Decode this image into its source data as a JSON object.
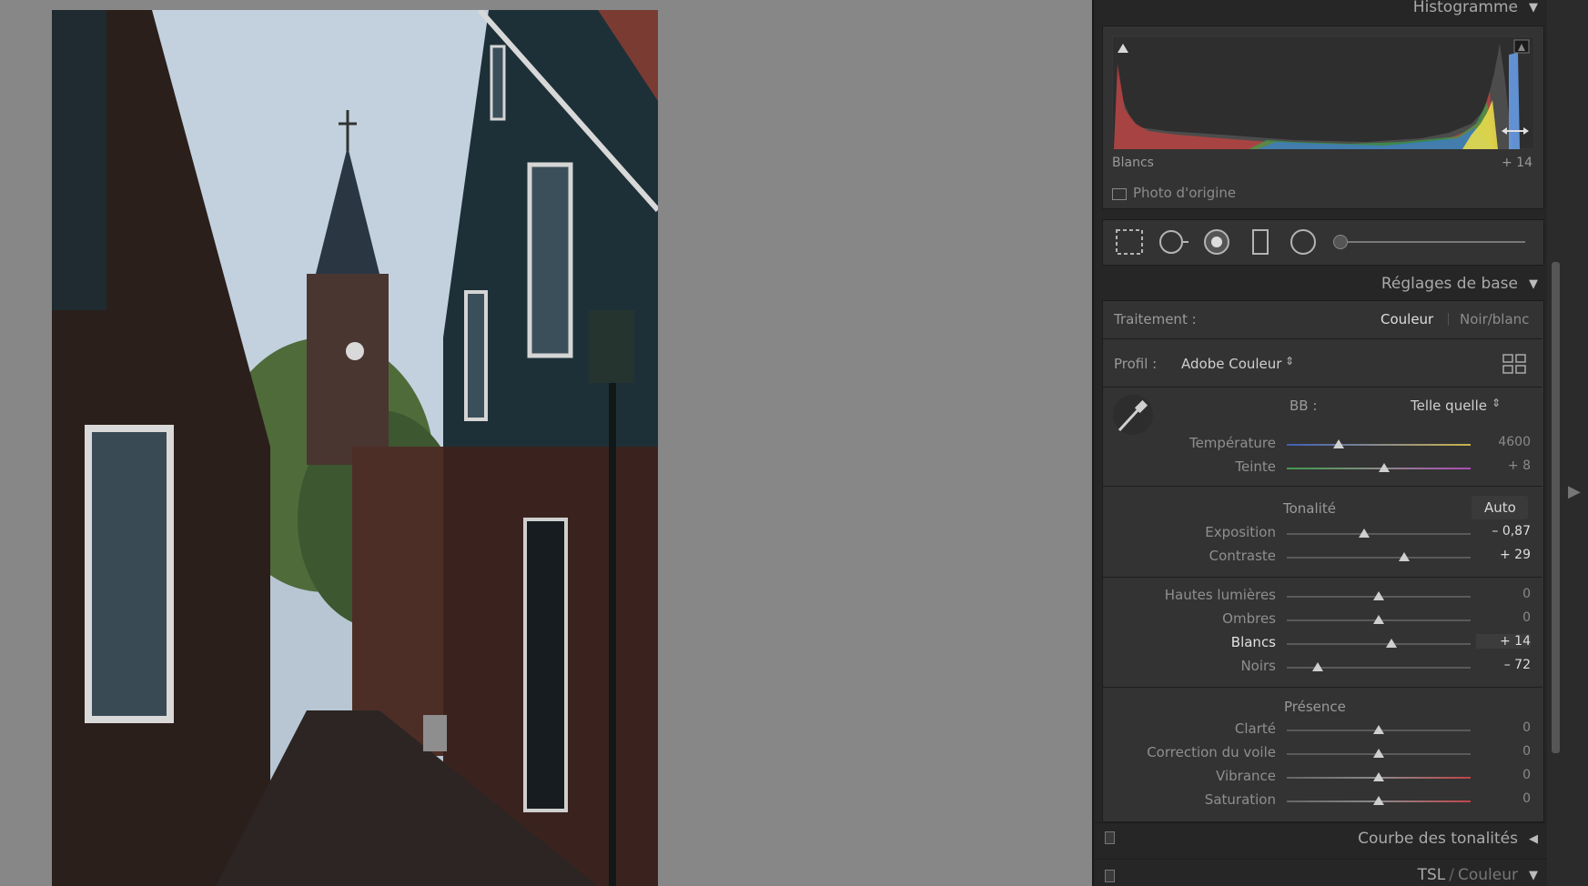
{
  "histogram": {
    "title": "Histogramme",
    "readout_label": "Blancs",
    "readout_value": "+ 14",
    "original_photo_label": "Photo d'origine"
  },
  "basic": {
    "title": "Réglages de base",
    "treatment_label": "Traitement :",
    "treatment_color": "Couleur",
    "treatment_bw": "Noir/blanc",
    "profile_label": "Profil :",
    "profile_value": "Adobe Couleur",
    "wb_label": "BB :",
    "wb_value": "Telle quelle",
    "tone_label": "Tonalité",
    "auto_label": "Auto",
    "presence_label": "Présence",
    "sliders": {
      "temperature": {
        "label": "Température",
        "value": "4600",
        "pos": 0.28
      },
      "tint": {
        "label": "Teinte",
        "value": "+ 8",
        "pos": 0.53
      },
      "exposure": {
        "label": "Exposition",
        "value": "– 0,87",
        "pos": 0.42
      },
      "contrast": {
        "label": "Contraste",
        "value": "+ 29",
        "pos": 0.64
      },
      "highlights": {
        "label": "Hautes lumières",
        "value": "0",
        "pos": 0.5
      },
      "shadows": {
        "label": "Ombres",
        "value": "0",
        "pos": 0.5
      },
      "whites": {
        "label": "Blancs",
        "value": "+ 14",
        "pos": 0.57
      },
      "blacks": {
        "label": "Noirs",
        "value": "– 72",
        "pos": 0.17
      },
      "clarity": {
        "label": "Clarté",
        "value": "0",
        "pos": 0.5
      },
      "dehaze": {
        "label": "Correction du voile",
        "value": "0",
        "pos": 0.5
      },
      "vibrance": {
        "label": "Vibrance",
        "value": "0",
        "pos": 0.5
      },
      "saturation": {
        "label": "Saturation",
        "value": "0",
        "pos": 0.5
      }
    }
  },
  "tone_curve": {
    "title": "Courbe des tonalités"
  },
  "hsl": {
    "title_a": "TSL",
    "title_sep": "/",
    "title_b": "Couleur"
  },
  "colors": {
    "panel": "#262626",
    "box": "#333333",
    "text": "#9a9a9a",
    "highlight": "#dedede"
  }
}
